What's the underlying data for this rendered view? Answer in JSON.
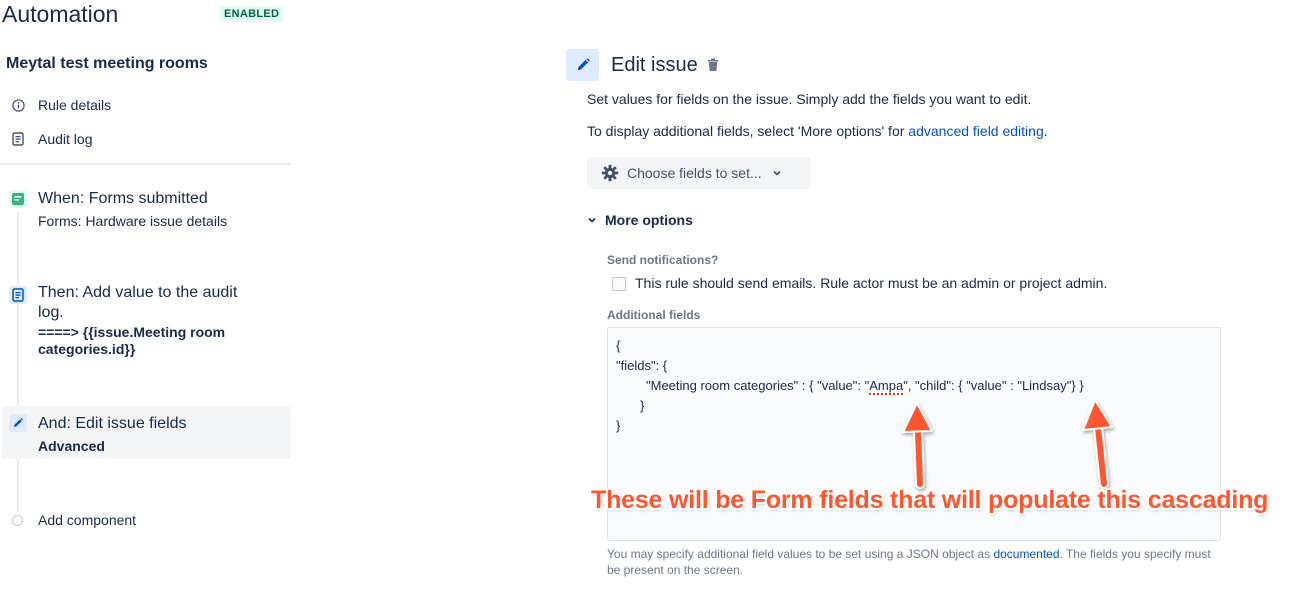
{
  "header": {
    "title": "Automation",
    "status_badge": "ENABLED"
  },
  "sidebar": {
    "rule_name": "Meytal test meeting rooms",
    "links": [
      {
        "label": "Rule details",
        "icon": "info-icon"
      },
      {
        "label": "Audit log",
        "icon": "document-icon"
      }
    ],
    "steps": [
      {
        "title": "When: Forms submitted",
        "subtitle": "Forms: Hardware issue details",
        "icon": "form-icon",
        "color": "#36b37e"
      },
      {
        "title_line1": "Then: Add value to the audit",
        "title_line2": "log.",
        "subtitle_line1": "====> {{issue.Meeting room",
        "subtitle_line2": "categories.id}}",
        "icon": "document-icon",
        "color": "#0052cc"
      },
      {
        "title": "And: Edit issue fields",
        "subtitle": "Advanced",
        "icon": "pencil-icon",
        "color": "#0052cc"
      }
    ],
    "add_component": "Add component"
  },
  "panel": {
    "title": "Edit issue",
    "description": "Set values for fields on the issue. Simply add the fields you want to edit.",
    "more_text_prefix": "To display additional fields, select 'More options' for ",
    "more_text_link": "advanced field editing",
    "more_text_suffix": ".",
    "choose_button": "Choose fields to set...",
    "more_options": "More options",
    "send_notifications_label": "Send notifications?",
    "send_notifications_checkbox": "This rule should send emails. Rule actor must be an admin or project admin.",
    "additional_fields_label": "Additional fields",
    "json_lines": {
      "l1": "{",
      "l2": "\"fields\": {",
      "l3_prefix": "\"Meeting room categories\" : { \"value\": \"",
      "l3_word": "Ampa",
      "l3_suffix": "\", \"child\": { \"value\" : \"Lindsay\"} }",
      "l4": "}",
      "l5": "}"
    },
    "help_prefix": "You may specify additional field values to be set using a JSON object as ",
    "help_link": "documented",
    "help_suffix": ". The fields you specify must be present on the screen."
  },
  "annotation": {
    "text": "These will be Form fields that will populate this cascading",
    "color": "#ff5630"
  }
}
